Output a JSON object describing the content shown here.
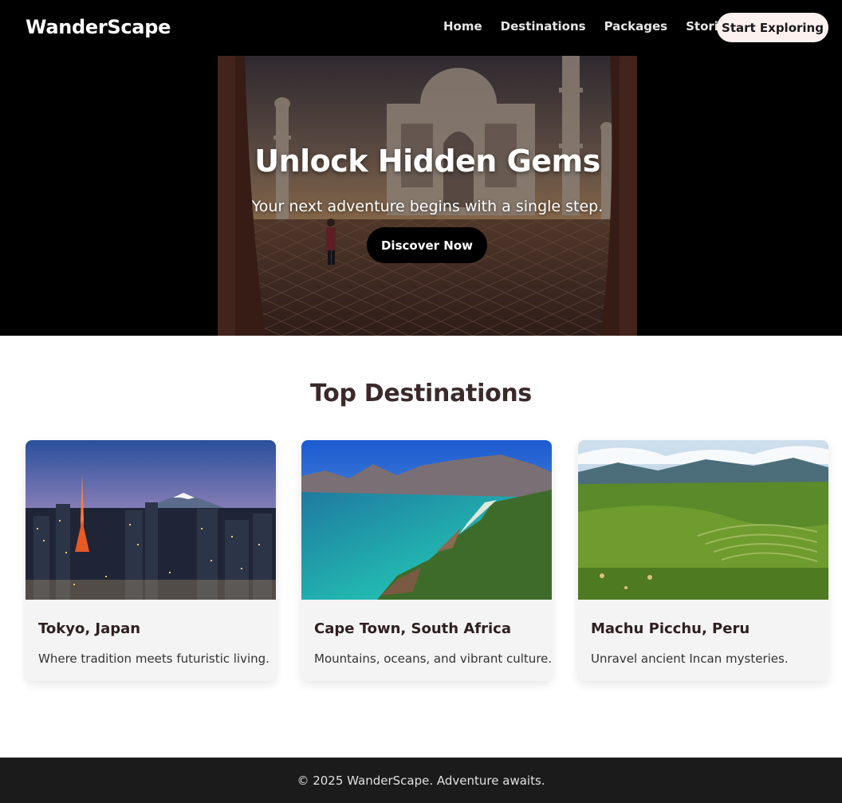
{
  "brand": "WanderScape",
  "nav": {
    "items": [
      "Home",
      "Destinations",
      "Packages",
      "Stories"
    ],
    "cta": "Start Exploring"
  },
  "hero": {
    "title": "Unlock Hidden Gems",
    "subtitle": "Your next adventure begins with a single step.",
    "button": "Discover Now"
  },
  "destinations": {
    "title": "Top Destinations",
    "cards": [
      {
        "title": "Tokyo, Japan",
        "desc": "Where tradition meets futuristic living."
      },
      {
        "title": "Cape Town, South Africa",
        "desc": "Mountains, oceans, and vibrant culture."
      },
      {
        "title": "Machu Picchu, Peru",
        "desc": "Unravel ancient Incan mysteries."
      }
    ]
  },
  "footer": {
    "text": "© 2025 WanderScape. Adventure awaits."
  }
}
